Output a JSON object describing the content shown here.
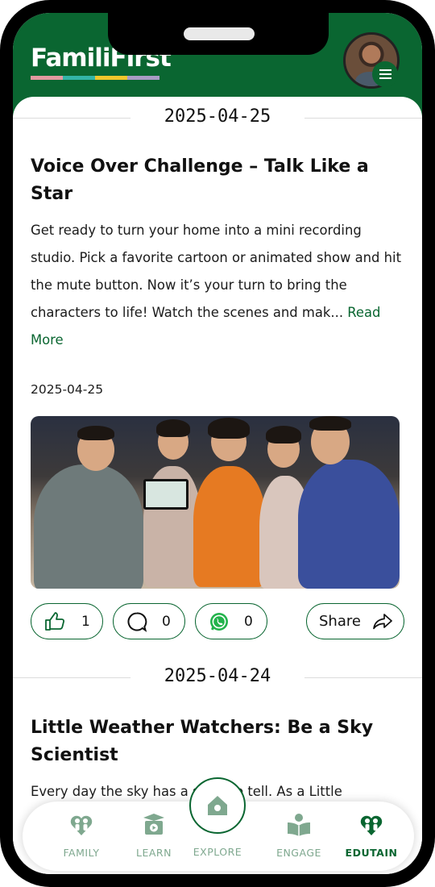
{
  "app": {
    "logo_text": "FamiliFirst",
    "logo_stripe_colors": [
      "#e29aa0",
      "#33b5a8",
      "#f0c62c",
      "#a79cc4"
    ],
    "brand_color": "#0a6631"
  },
  "feed": {
    "posts": [
      {
        "section_date": "2025-04-25",
        "title": "Voice Over Challenge – Talk Like a Star",
        "excerpt": "Get ready to turn your home into a mini recording studio. Pick a favorite cartoon or animated show and hit the mute button. Now it’s your turn to bring the characters to life! Watch the scenes and mak...",
        "read_more": "Read More",
        "date": "2025-04-25",
        "likes": "1",
        "comments": "0",
        "whatsapp": "0",
        "share_label": "Share"
      },
      {
        "section_date": "2025-04-24",
        "title": "Little Weather Watchers: Be a Sky Scientist",
        "excerpt": "Every day the sky has a story to tell. As a Little"
      }
    ]
  },
  "bottom_nav": {
    "items": [
      {
        "label": "FAMILY",
        "icon": "family-icon"
      },
      {
        "label": "LEARN",
        "icon": "learn-icon"
      },
      {
        "label": "EXPLORE",
        "icon": "home-icon"
      },
      {
        "label": "ENGAGE",
        "icon": "engage-icon"
      },
      {
        "label": "EDUTAIN",
        "icon": "edutain-icon",
        "active": true
      }
    ]
  }
}
